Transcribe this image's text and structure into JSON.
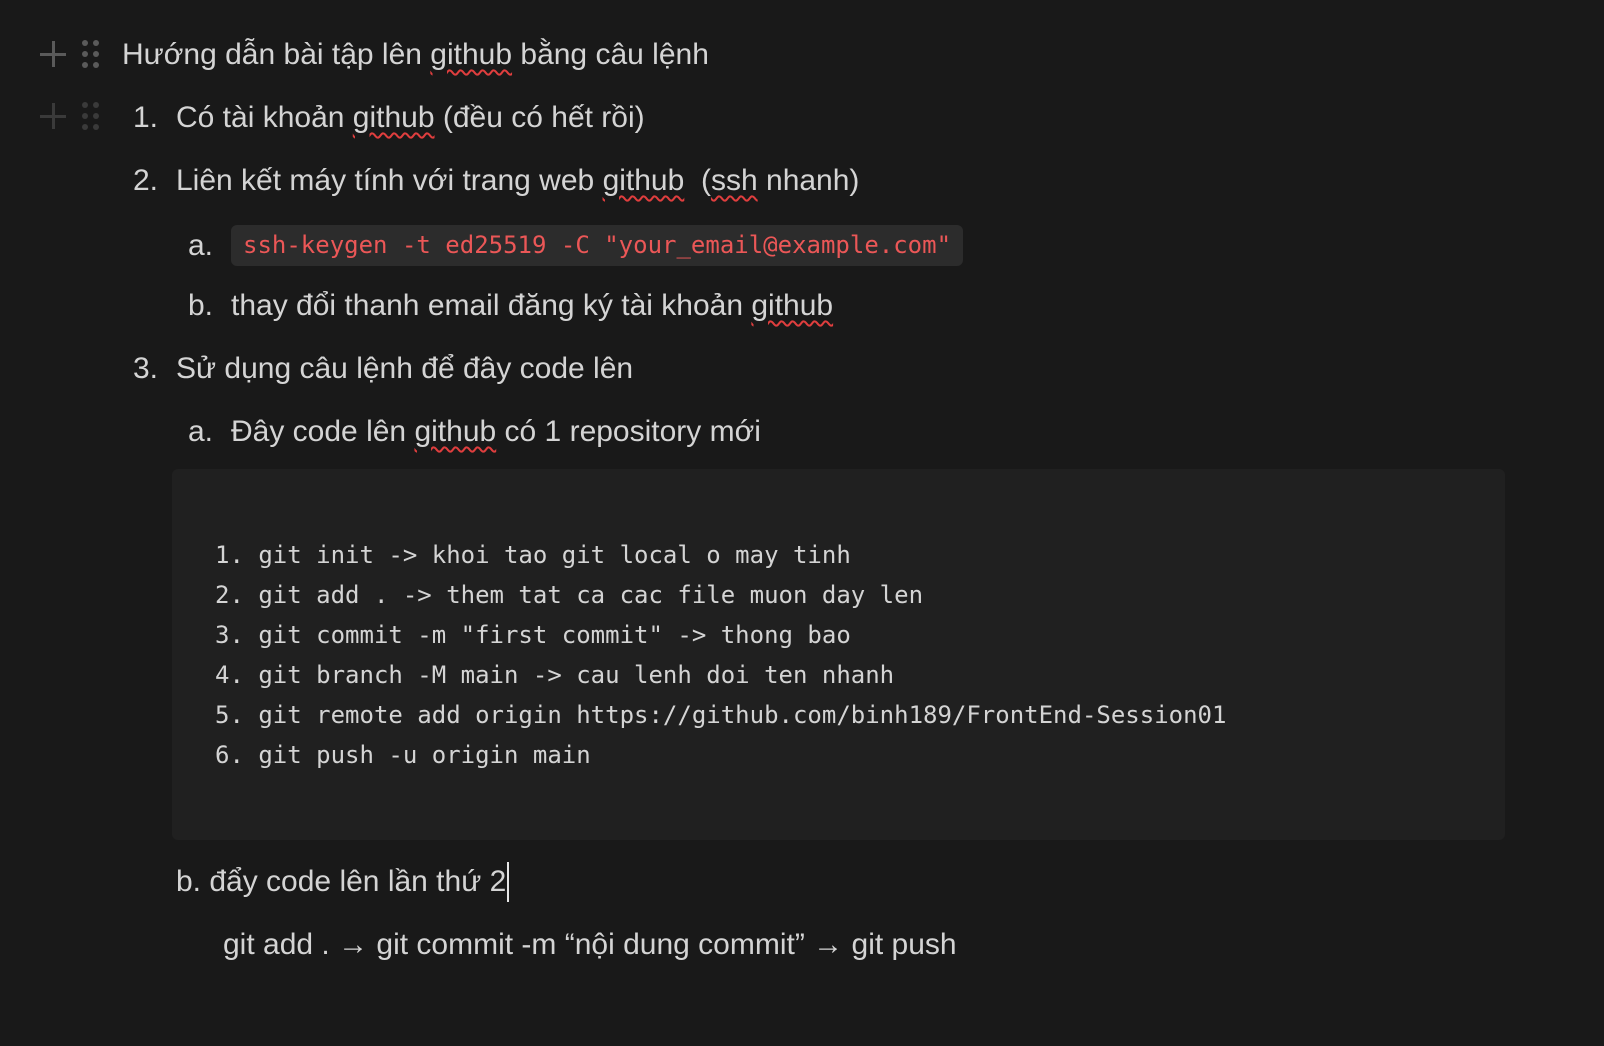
{
  "doc": {
    "heading": {
      "before": "Hướng dẫn bài tập lên ",
      "spell": "github",
      "after": " bằng câu lệnh"
    },
    "items": [
      {
        "marker": "1.",
        "before": "Có tài khoản ",
        "spell": "github",
        "after": " (đều có hết rồi)"
      },
      {
        "marker": "2.",
        "before": "Liên kết máy tính với trang web ",
        "spell": "github",
        "middle": "  (",
        "spell2": "ssh",
        "after": " nhanh)"
      },
      {
        "marker": "3.",
        "text": "Sử dụng câu lệnh để đây code lên"
      }
    ],
    "sub_items_2": [
      {
        "marker": "a.",
        "code": "ssh-keygen -t ed25519 -C \"your_email@example.com\""
      },
      {
        "marker": "b.",
        "before": "thay đổi thanh email đăng ký tài khoản ",
        "spell": "github"
      }
    ],
    "sub_items_3": [
      {
        "marker": "a.",
        "before": "Đây code lên ",
        "spell": "github",
        "after": " có 1 repository mới"
      }
    ],
    "code_block": {
      "lines": [
        "1. git init -> khoi tao git local o may tinh",
        "2. git add . -> them tat ca cac file muon day len",
        "3. git commit -m \"first commit\" -> thong bao",
        "4. git branch -M main -> cau lenh doi ten nhanh",
        "5. git remote add origin https://github.com/binh189/FrontEnd-Session01",
        "6. git push -u origin main"
      ]
    },
    "second_push": {
      "label": "b. đẩy code lên lần thứ 2",
      "command": "git add . → git commit -m “nội dung commit” → git push"
    }
  },
  "colors": {
    "background": "#191919",
    "text": "#d4d4d4",
    "inline_code_text": "#eb5757",
    "inline_code_bg": "#2c2c2c",
    "code_block_bg": "#202020",
    "spellcheck": "#e03e3e"
  },
  "icons": [
    "plus-icon",
    "drag-handle-icon"
  ]
}
